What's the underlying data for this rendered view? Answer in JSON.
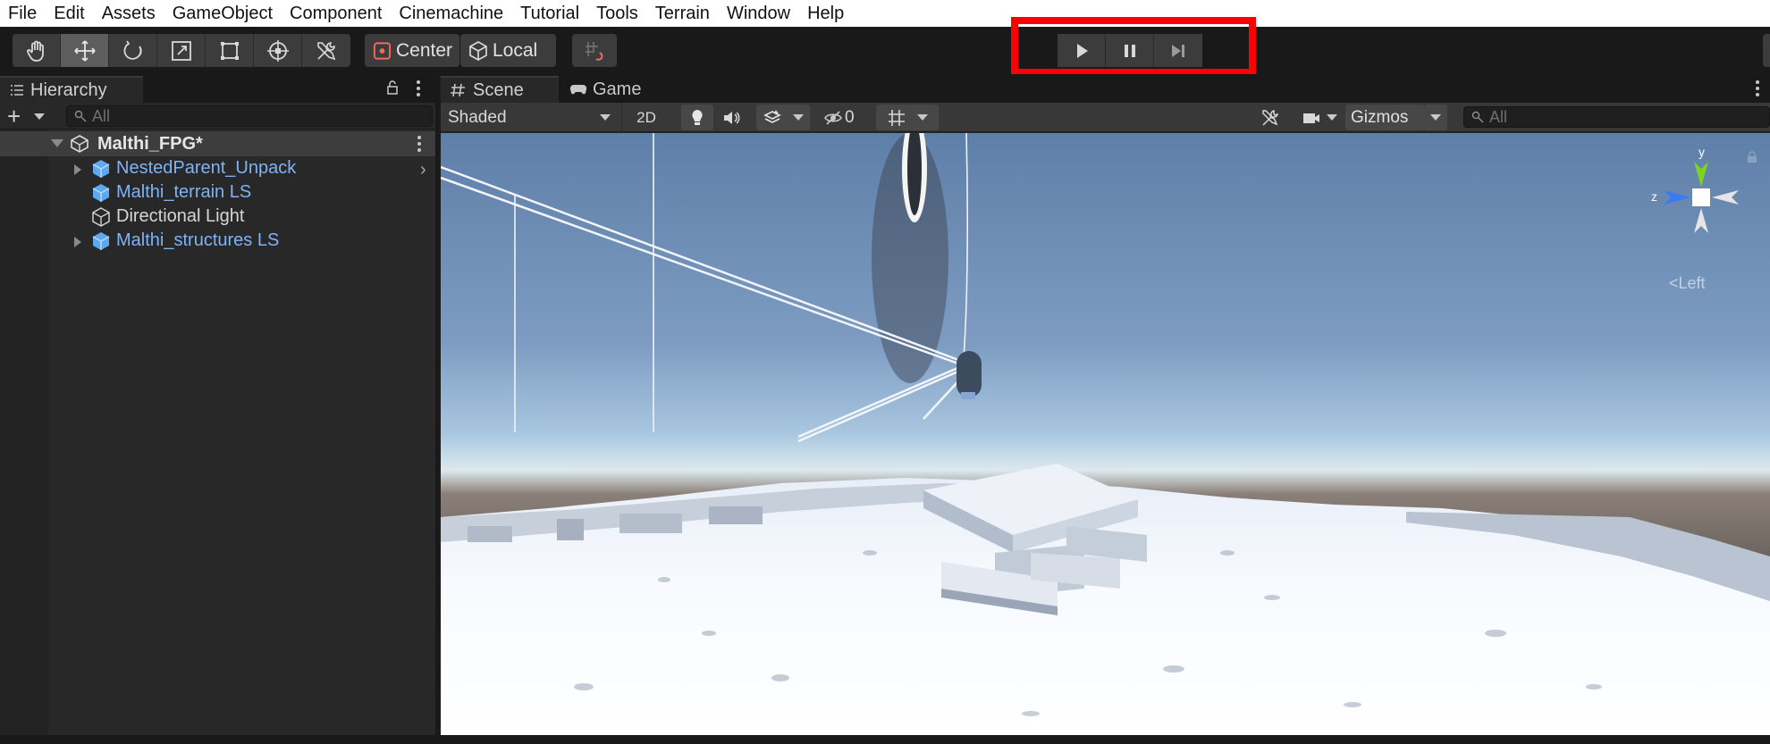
{
  "menu": [
    "File",
    "Edit",
    "Assets",
    "GameObject",
    "Component",
    "Cinemachine",
    "Tutorial",
    "Tools",
    "Terrain",
    "Window",
    "Help"
  ],
  "toolbar": {
    "tools": [
      "hand-tool-icon",
      "move-tool-icon",
      "rotate-tool-icon",
      "scale-tool-icon",
      "rect-tool-icon",
      "transform-tool-icon",
      "custom-tools-icon"
    ],
    "active_tool": "move-tool-icon",
    "pivot_mode": "Center",
    "pivot_rotation": "Local",
    "play_controls": [
      "play-icon",
      "pause-icon",
      "step-icon"
    ],
    "highlight_color": "#ff0000"
  },
  "hierarchy": {
    "tab_label": "Hierarchy",
    "search_placeholder": "All",
    "scene_name": "Malthi_FPG*",
    "items": [
      {
        "label": "NestedParent_Unpack",
        "type": "prefab",
        "has_children": true
      },
      {
        "label": "Malthi_terrain LS",
        "type": "prefab",
        "has_children": false
      },
      {
        "label": "Directional Light",
        "type": "gameobject",
        "has_children": false
      },
      {
        "label": "Malthi_structures LS",
        "type": "prefab",
        "has_children": true
      }
    ]
  },
  "scene": {
    "tabs": [
      {
        "label": "Scene",
        "active": true
      },
      {
        "label": "Game",
        "active": false
      }
    ],
    "draw_mode": "Shaded",
    "mode_2d": "2D",
    "hidden_count": "0",
    "gizmos_label": "Gizmos",
    "search_placeholder": "All",
    "gizmo_axis_y": "y",
    "gizmo_axis_z": "z",
    "view_label": "Left"
  },
  "colors": {
    "prefab_text": "#7fb3f5",
    "gizmo_y": "#7ed321",
    "gizmo_z": "#3a7bf2"
  }
}
